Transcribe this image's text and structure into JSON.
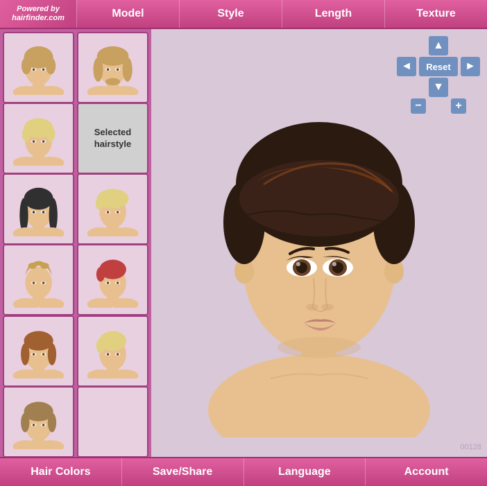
{
  "nav": {
    "logo_line1": "Powered by",
    "logo_line2": "hairfinder.com",
    "tabs": [
      "Model",
      "Style",
      "Length",
      "Texture"
    ]
  },
  "sidebar": {
    "selected_label": "Selected hairstyle",
    "thumbnails": [
      {
        "id": 1,
        "hair_color": "#c8a060",
        "type": "short-wavy"
      },
      {
        "id": 2,
        "hair_color": "#c8a060",
        "type": "medium-curly"
      },
      {
        "id": 3,
        "hair_color": "#e0d080",
        "type": "short-straight"
      },
      {
        "id": 4,
        "hair_color": "#808080",
        "type": "selected-placeholder"
      },
      {
        "id": 5,
        "hair_color": "#404040",
        "type": "long-straight"
      },
      {
        "id": 6,
        "hair_color": "#e0d080",
        "type": "short-pixie"
      },
      {
        "id": 7,
        "hair_color": "#e0d080",
        "type": "short-textured"
      },
      {
        "id": 8,
        "hair_color": "#c04040",
        "type": "short-pixie2"
      },
      {
        "id": 9,
        "hair_color": "#a06030",
        "type": "short-bob"
      },
      {
        "id": 10,
        "hair_color": "#e0d080",
        "type": "short-side"
      },
      {
        "id": 11,
        "hair_color": "#a08050",
        "type": "short-bob2"
      }
    ]
  },
  "controls": {
    "reset_label": "Reset",
    "up_icon": "▲",
    "down_icon": "▼",
    "left_icon": "◄",
    "right_icon": "►",
    "minus_icon": "−",
    "plus_icon": "+"
  },
  "preview": {
    "watermark": "00128"
  },
  "bottom": {
    "buttons": [
      "Hair Colors",
      "Save/Share",
      "Language",
      "Account"
    ]
  }
}
